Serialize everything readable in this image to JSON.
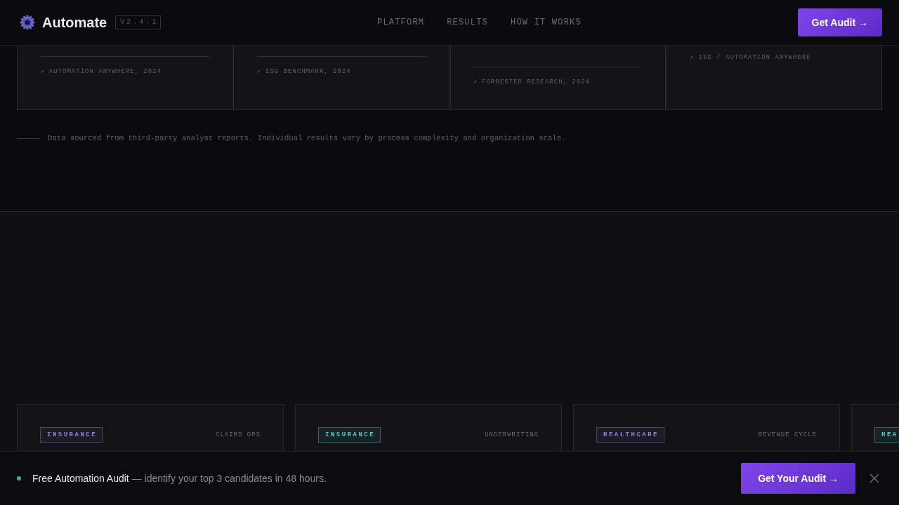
{
  "header": {
    "brand": "Automate",
    "version": "V2.4.1",
    "nav": [
      {
        "label": "PLATFORM"
      },
      {
        "label": "RESULTS"
      },
      {
        "label": "HOW IT WORKS"
      }
    ],
    "cta": "Get Audit →"
  },
  "stat_cards": [
    {
      "source": "↗ AUTOMATION ANYWHERE, 2024"
    },
    {
      "source": "↗ ISG BENCHMARK, 2024"
    },
    {
      "source": "↗ FORRESTER RESEARCH, 2024"
    },
    {
      "source": "↗ ISG / AUTOMATION ANYWHERE"
    }
  ],
  "footnote": "Data sourced from third-party analyst reports. Individual results vary by process complexity and organization scale.",
  "case_cards": [
    {
      "tag": "INSURANCE",
      "color": "#8e82d8",
      "label": "CLAIMS OPS"
    },
    {
      "tag": "INSURANCE",
      "color": "#5cc6cc",
      "label": "UNDERWRITING"
    },
    {
      "tag": "HEALTHCARE",
      "color": "#8e82d8",
      "label": "REVENUE CYCLE"
    },
    {
      "tag": "HEA",
      "color": "#5cc6cc"
    }
  ],
  "banner": {
    "title": "Free Automation Audit",
    "message": "— identify your top 3 candidates in 48 hours.",
    "button": "Get Your Audit →"
  }
}
